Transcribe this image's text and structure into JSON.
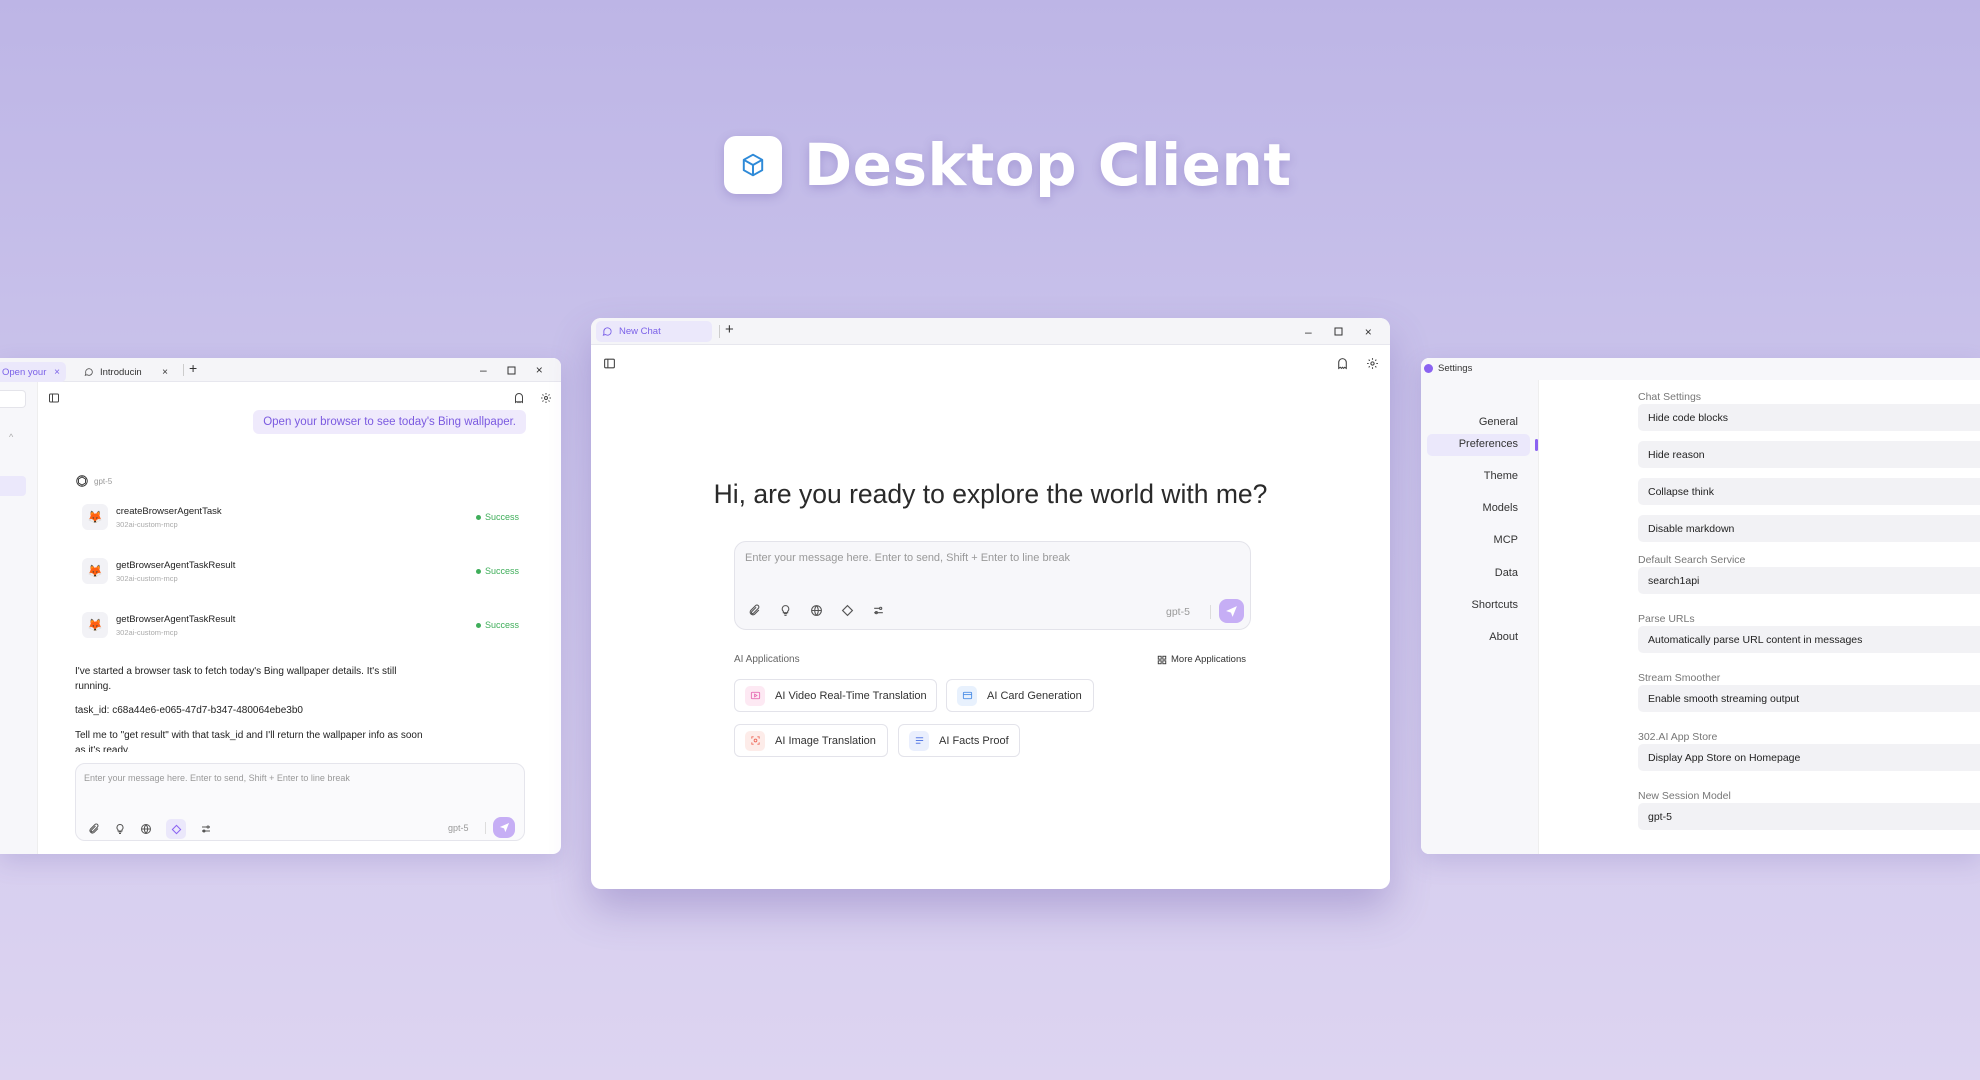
{
  "hero": {
    "title": "Desktop Client",
    "logo_icon": "cube-icon"
  },
  "left_window": {
    "tabs": [
      {
        "label": "Open your",
        "active": true
      },
      {
        "label": "Introducin",
        "active": false
      }
    ],
    "user_message": "Open your browser to see today's Bing wallpaper.",
    "model": "gpt-5",
    "tool_calls": [
      {
        "name": "createBrowserAgentTask",
        "server": "302ai-custom-mcp",
        "status": "Success"
      },
      {
        "name": "getBrowserAgentTaskResult",
        "server": "302ai-custom-mcp",
        "status": "Success"
      },
      {
        "name": "getBrowserAgentTaskResult",
        "server": "302ai-custom-mcp",
        "status": "Success"
      }
    ],
    "reply_lines": [
      "I've started a browser task to fetch today's Bing wallpaper details. It's still",
      "running.",
      "task_id: c68a44e6-e065-47d7-b347-480064ebe3b0",
      "Tell me to \"get result\" with that task_id and I'll return the wallpaper info as soon",
      "as it's ready."
    ],
    "input_placeholder": "Enter your message here. Enter to send, Shift + Enter to line break",
    "input_model": "gpt-5"
  },
  "center_window": {
    "tab_label": "New Chat",
    "greeting": "Hi, are you ready to explore the world with me?",
    "input_placeholder": "Enter your message here. Enter to send, Shift + Enter to line break",
    "input_model": "gpt-5",
    "ai_apps_heading": "AI Applications",
    "more_apps_label": "More Applications",
    "apps": [
      {
        "label": "AI Video Real-Time Translation",
        "icon": "video-translate-icon",
        "color": "#e76fb5"
      },
      {
        "label": "AI Card Generation",
        "icon": "card-icon",
        "color": "#4e8fe6"
      },
      {
        "label": "AI Image Translation",
        "icon": "image-translate-icon",
        "color": "#ee6a5b"
      },
      {
        "label": "AI Facts Proof",
        "icon": "list-check-icon",
        "color": "#5a7de6"
      }
    ]
  },
  "right_window": {
    "title": "Settings",
    "nav": [
      "General",
      "Preferences",
      "Theme",
      "Models",
      "MCP",
      "Data",
      "Shortcuts",
      "About"
    ],
    "active_nav": "Preferences",
    "chat_settings_label": "Chat Settings",
    "chat_settings": [
      "Hide code blocks",
      "Hide reason",
      "Collapse think",
      "Disable markdown"
    ],
    "search_label": "Default Search Service",
    "search_value": "search1api",
    "parse_label": "Parse URLs",
    "parse_value": "Automatically parse URL content in messages",
    "stream_label": "Stream Smoother",
    "stream_value": "Enable smooth streaming output",
    "store_label": "302.AI App Store",
    "store_value": "Display App Store on Homepage",
    "session_label": "New Session Model",
    "session_value": "gpt-5"
  },
  "colors": {
    "accent": "#8b63f1",
    "accent_soft": "#ebe8fb",
    "success": "#3fae5a",
    "send": "#c6aef5"
  }
}
